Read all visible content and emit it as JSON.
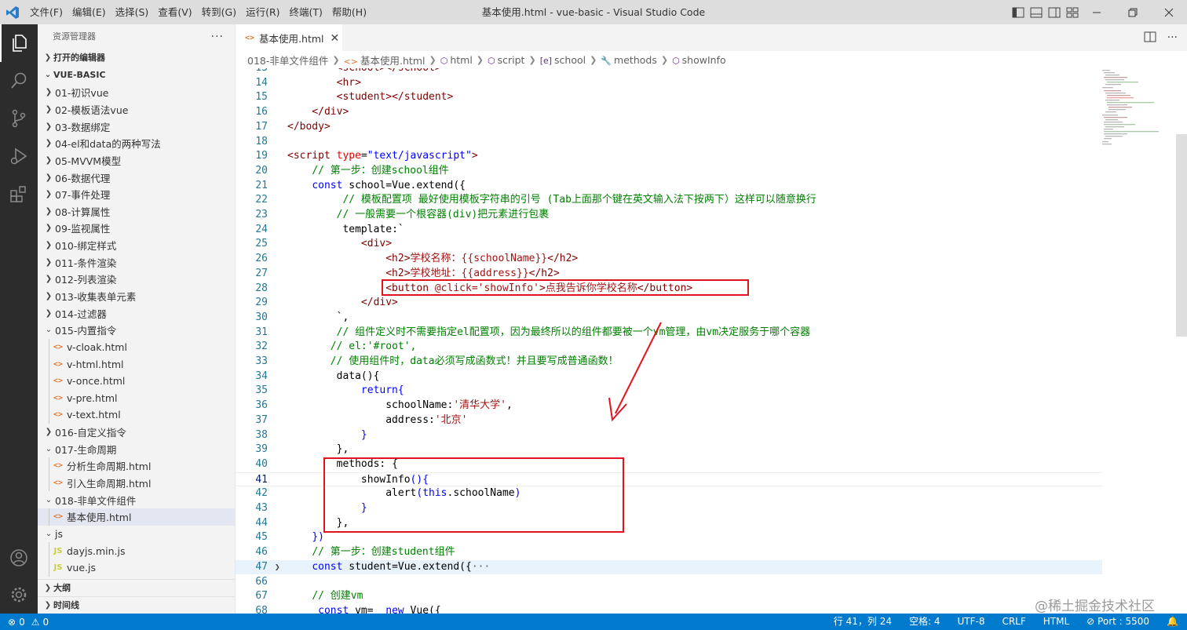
{
  "window": {
    "title": "基本使用.html - vue-basic - Visual Studio Code",
    "menu": [
      "文件(F)",
      "编辑(E)",
      "选择(S)",
      "查看(V)",
      "转到(G)",
      "运行(R)",
      "终端(T)",
      "帮助(H)"
    ]
  },
  "sidebar": {
    "title": "资源管理器",
    "more": "···",
    "open_editors": "打开的编辑器",
    "root": "VUE-BASIC",
    "items": [
      {
        "label": "01-初识vue",
        "kind": "folder",
        "depth": 1,
        "open": false
      },
      {
        "label": "02-模板语法vue",
        "kind": "folder",
        "depth": 1,
        "open": false
      },
      {
        "label": "03-数据绑定",
        "kind": "folder",
        "depth": 1,
        "open": false
      },
      {
        "label": "04-el和data的两种写法",
        "kind": "folder",
        "depth": 1,
        "open": false
      },
      {
        "label": "05-MVVM模型",
        "kind": "folder",
        "depth": 1,
        "open": false
      },
      {
        "label": "06-数据代理",
        "kind": "folder",
        "depth": 1,
        "open": false
      },
      {
        "label": "07-事件处理",
        "kind": "folder",
        "depth": 1,
        "open": false
      },
      {
        "label": "08-计算属性",
        "kind": "folder",
        "depth": 1,
        "open": false
      },
      {
        "label": "09-监视属性",
        "kind": "folder",
        "depth": 1,
        "open": false
      },
      {
        "label": "010-绑定样式",
        "kind": "folder",
        "depth": 1,
        "open": false
      },
      {
        "label": "011-条件渲染",
        "kind": "folder",
        "depth": 1,
        "open": false
      },
      {
        "label": "012-列表渲染",
        "kind": "folder",
        "depth": 1,
        "open": false
      },
      {
        "label": "013-收集表单元素",
        "kind": "folder",
        "depth": 1,
        "open": false
      },
      {
        "label": "014-过滤器",
        "kind": "folder",
        "depth": 1,
        "open": false
      },
      {
        "label": "015-内置指令",
        "kind": "folder",
        "depth": 1,
        "open": true
      },
      {
        "label": "v-cloak.html",
        "kind": "html",
        "depth": 2
      },
      {
        "label": "v-html.html",
        "kind": "html",
        "depth": 2
      },
      {
        "label": "v-once.html",
        "kind": "html",
        "depth": 2
      },
      {
        "label": "v-pre.html",
        "kind": "html",
        "depth": 2
      },
      {
        "label": "v-text.html",
        "kind": "html",
        "depth": 2
      },
      {
        "label": "016-自定义指令",
        "kind": "folder",
        "depth": 1,
        "open": false
      },
      {
        "label": "017-生命周期",
        "kind": "folder",
        "depth": 1,
        "open": true
      },
      {
        "label": "分析生命周期.html",
        "kind": "html",
        "depth": 2
      },
      {
        "label": "引入生命周期.html",
        "kind": "html",
        "depth": 2
      },
      {
        "label": "018-非单文件组件",
        "kind": "folder",
        "depth": 1,
        "open": true
      },
      {
        "label": "基本使用.html",
        "kind": "html",
        "depth": 2,
        "selected": true
      },
      {
        "label": "js",
        "kind": "folder",
        "depth": 1,
        "open": true
      },
      {
        "label": "dayjs.min.js",
        "kind": "js",
        "depth": 2
      },
      {
        "label": "vue.js",
        "kind": "js",
        "depth": 2
      }
    ],
    "outline": "大纲",
    "timeline": "时间线"
  },
  "tabs": [
    {
      "label": "基本使用.html",
      "active": true
    }
  ],
  "breadcrumbs": [
    {
      "label": "018-非单文件组件",
      "icon": ""
    },
    {
      "label": "基本使用.html",
      "icon": "<>"
    },
    {
      "label": "html",
      "icon": "⬡"
    },
    {
      "label": "script",
      "icon": "⬡"
    },
    {
      "label": "school",
      "icon": "[e]"
    },
    {
      "label": "methods",
      "icon": "🔧"
    },
    {
      "label": "showInfo",
      "icon": "⬡"
    }
  ],
  "code_lines": [
    {
      "n": "13",
      "tokens": [
        [
          "        ",
          "p"
        ],
        [
          "<school></school>",
          "tag"
        ]
      ]
    },
    {
      "n": "14",
      "tokens": [
        [
          "        ",
          "p"
        ],
        [
          "<hr>",
          "tag"
        ]
      ]
    },
    {
      "n": "15",
      "tokens": [
        [
          "        ",
          "p"
        ],
        [
          "<student></student>",
          "tag"
        ]
      ]
    },
    {
      "n": "16",
      "tokens": [
        [
          "    ",
          "p"
        ],
        [
          "</div>",
          "tag"
        ]
      ]
    },
    {
      "n": "17",
      "tokens": [
        [
          "</body>",
          "tag"
        ]
      ]
    },
    {
      "n": "18",
      "tokens": []
    },
    {
      "n": "19",
      "tokens": [
        [
          "<script ",
          "tag"
        ],
        [
          "type",
          "attr"
        ],
        [
          "=",
          "p"
        ],
        [
          "\"text/javascript\"",
          "kw"
        ],
        [
          ">",
          "tag"
        ]
      ]
    },
    {
      "n": "20",
      "tokens": [
        [
          "    ",
          "p"
        ],
        [
          "// 第一步：创建school组件",
          "cm"
        ]
      ]
    },
    {
      "n": "21",
      "tokens": [
        [
          "    ",
          "p"
        ],
        [
          "const",
          "kw"
        ],
        [
          " school=Vue.extend({",
          "p"
        ]
      ]
    },
    {
      "n": "22",
      "tokens": [
        [
          "         ",
          "p"
        ],
        [
          "// 模板配置项 最好使用模板字符串的引号 (Tab上面那个键在英文输入法下按两下）这样可以随意换行",
          "cm"
        ]
      ]
    },
    {
      "n": "23",
      "tokens": [
        [
          "        ",
          "p"
        ],
        [
          "// 一般需要一个根容器(div)把元素进行包裹",
          "cm"
        ]
      ]
    },
    {
      "n": "24",
      "tokens": [
        [
          "         ",
          "p"
        ],
        [
          "template:`",
          "p"
        ]
      ]
    },
    {
      "n": "25",
      "tokens": [
        [
          "            ",
          "p"
        ],
        [
          "<div>",
          "tag"
        ]
      ]
    },
    {
      "n": "26",
      "tokens": [
        [
          "                ",
          "p"
        ],
        [
          "<h2>",
          "tag"
        ],
        [
          "学校名称：{{schoolName}}",
          "str"
        ],
        [
          "</h2>",
          "tag"
        ]
      ]
    },
    {
      "n": "27",
      "tokens": [
        [
          "                ",
          "p"
        ],
        [
          "<h2>",
          "tag"
        ],
        [
          "学校地址：{{address}}",
          "str"
        ],
        [
          "</h2>",
          "tag"
        ]
      ]
    },
    {
      "n": "28",
      "tokens": [
        [
          "                ",
          "p"
        ],
        [
          "<button ",
          "tag"
        ],
        [
          "@click=",
          "str"
        ],
        [
          "'showInfo'",
          "str"
        ],
        [
          ">",
          "tag"
        ],
        [
          "点我告诉你学校名称",
          "str"
        ],
        [
          "</button>",
          "tag"
        ]
      ]
    },
    {
      "n": "29",
      "tokens": [
        [
          "            ",
          "p"
        ],
        [
          "</div>",
          "tag"
        ]
      ]
    },
    {
      "n": "30",
      "tokens": [
        [
          "        ",
          "p"
        ],
        [
          "`,",
          "p"
        ]
      ]
    },
    {
      "n": "31",
      "tokens": [
        [
          "        ",
          "p"
        ],
        [
          "// 组件定义时不需要指定el配置项，因为最终所以的组件都要被一个vm管理，由vm决定服务于哪个容器",
          "cm"
        ]
      ]
    },
    {
      "n": "32",
      "tokens": [
        [
          "       ",
          "p"
        ],
        [
          "// el:'#root',",
          "cm"
        ]
      ]
    },
    {
      "n": "33",
      "tokens": [
        [
          "       ",
          "p"
        ],
        [
          "// 使用组件时，data必须写成函数式！并且要写成普通函数！",
          "cm"
        ]
      ]
    },
    {
      "n": "34",
      "tokens": [
        [
          "        ",
          "p"
        ],
        [
          "data(){",
          "p"
        ]
      ]
    },
    {
      "n": "35",
      "tokens": [
        [
          "            ",
          "p"
        ],
        [
          "return",
          "kw"
        ],
        [
          "{",
          "kw"
        ]
      ]
    },
    {
      "n": "36",
      "tokens": [
        [
          "                ",
          "p"
        ],
        [
          "schoolName:",
          "p"
        ],
        [
          "'清华大学'",
          "str"
        ],
        [
          ",",
          "p"
        ]
      ]
    },
    {
      "n": "37",
      "tokens": [
        [
          "                ",
          "p"
        ],
        [
          "address:",
          "p"
        ],
        [
          "'北京'",
          "str"
        ]
      ]
    },
    {
      "n": "38",
      "tokens": [
        [
          "            ",
          "p"
        ],
        [
          "}",
          "kw"
        ]
      ]
    },
    {
      "n": "39",
      "tokens": [
        [
          "        ",
          "p"
        ],
        [
          "},",
          "p"
        ]
      ]
    },
    {
      "n": "40",
      "tokens": [
        [
          "        ",
          "p"
        ],
        [
          "methods: {",
          "p"
        ]
      ]
    },
    {
      "n": "41",
      "tokens": [
        [
          "            ",
          "p"
        ],
        [
          "showInfo",
          "p"
        ],
        [
          "(){",
          "kw"
        ]
      ],
      "current": true
    },
    {
      "n": "42",
      "tokens": [
        [
          "                ",
          "p"
        ],
        [
          "alert",
          "p"
        ],
        [
          "(",
          "kw"
        ],
        [
          "this",
          "kw"
        ],
        [
          ".schoolName",
          "p"
        ],
        [
          ")",
          "kw"
        ]
      ]
    },
    {
      "n": "43",
      "tokens": [
        [
          "            ",
          "p"
        ],
        [
          "}",
          "kw"
        ]
      ]
    },
    {
      "n": "44",
      "tokens": [
        [
          "        ",
          "p"
        ],
        [
          "},",
          "p"
        ]
      ]
    },
    {
      "n": "45",
      "tokens": [
        [
          "    ",
          "p"
        ],
        [
          "})",
          "kw"
        ]
      ]
    },
    {
      "n": "46",
      "tokens": [
        [
          "    ",
          "p"
        ],
        [
          "// 第一步：创建student组件",
          "cm"
        ]
      ]
    },
    {
      "n": "47",
      "tokens": [
        [
          "    ",
          "p"
        ],
        [
          "const",
          "kw"
        ],
        [
          " student=Vue.extend({",
          "p"
        ],
        [
          "···",
          "ell"
        ]
      ],
      "folded": true
    },
    {
      "n": "66",
      "tokens": []
    },
    {
      "n": "67",
      "tokens": [
        [
          "    ",
          "p"
        ],
        [
          "// 创建vm",
          "cm"
        ]
      ]
    },
    {
      "n": "68",
      "tokens": [
        [
          "     ",
          "p"
        ],
        [
          "const",
          "kw"
        ],
        [
          " vm=  ",
          "p"
        ],
        [
          "new",
          "kw"
        ],
        [
          " Vue({",
          "p"
        ]
      ]
    }
  ],
  "status": {
    "errors": "0",
    "warnings": "0",
    "position": "行 41，列 24",
    "spaces": "空格: 4",
    "encoding": "UTF-8",
    "eol": "CRLF",
    "language": "HTML",
    "port": "Port : 5500"
  },
  "watermark": "@稀土掘金技术社区",
  "colors": {
    "accent": "#007acc",
    "annotation": "#e0141e"
  }
}
